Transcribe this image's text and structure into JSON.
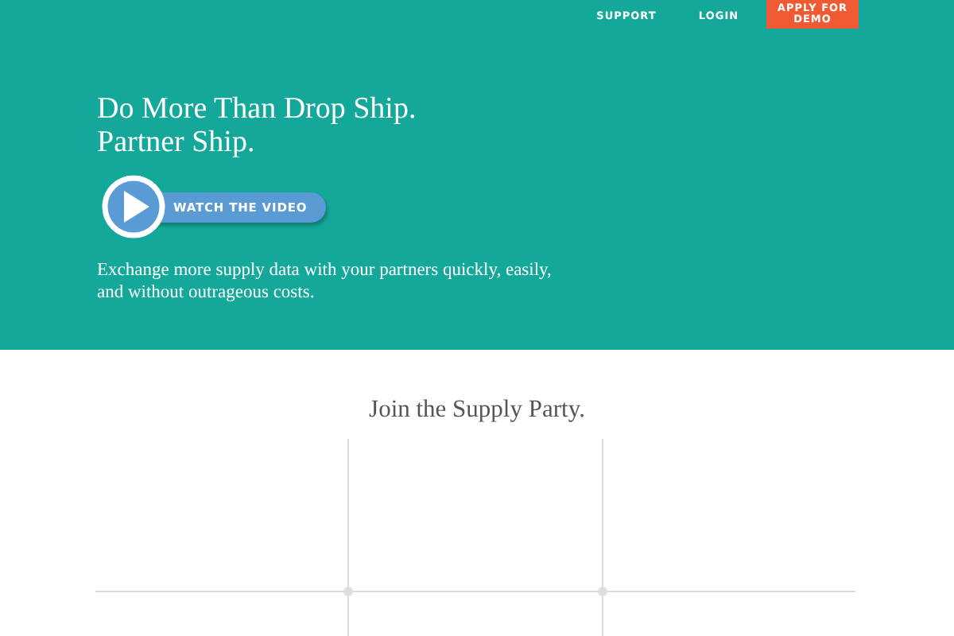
{
  "nav": {
    "links": [
      "SUPPORT",
      "LOGIN"
    ],
    "cta": "APPLY FOR\nDEMO"
  },
  "hero": {
    "headline": [
      "Do More Than Drop Ship.",
      "Partner Ship."
    ],
    "video_button": "WATCH THE VIDEO",
    "description": "Exchange more supply data with your partners quickly, easily, and without outrageous costs."
  },
  "section": {
    "title": "Join the Supply Party."
  }
}
